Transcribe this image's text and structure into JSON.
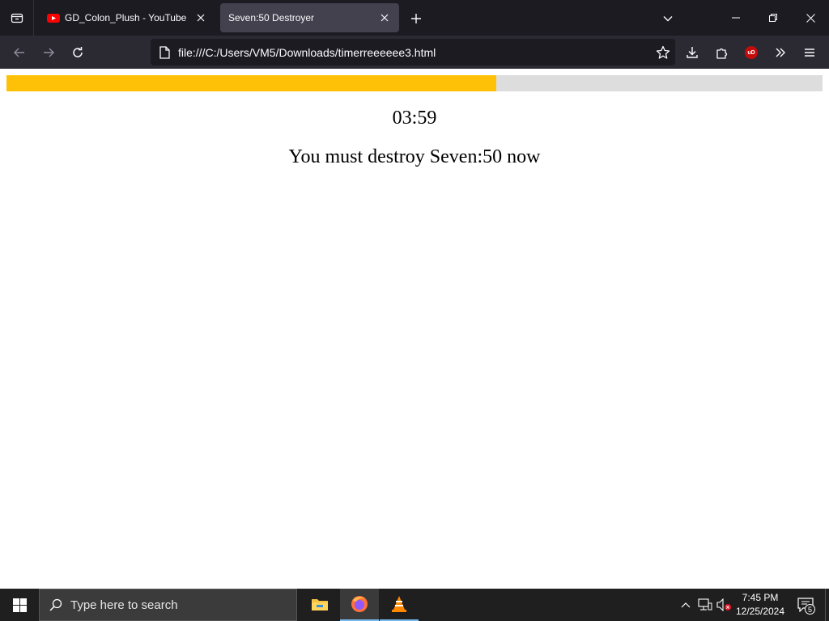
{
  "browser": {
    "tabs": [
      {
        "title": "GD_Colon_Plush - YouTube",
        "favicon": "youtube-icon",
        "active": false
      },
      {
        "title": "Seven:50 Destroyer",
        "active": true
      }
    ],
    "url": "file:///C:/Users/VM5/Downloads/timerreeeeee3.html",
    "extension_badge": "uD"
  },
  "page": {
    "progress_fraction": 0.6,
    "progress_color": "#ffc107",
    "track_color": "#dddddd",
    "timer": "03:59",
    "message": "You must destroy Seven:50 now"
  },
  "taskbar": {
    "search_placeholder": "Type here to search",
    "apps": [
      "file-explorer-icon",
      "firefox-icon",
      "vlc-icon"
    ],
    "time": "7:45 PM",
    "date": "12/25/2024",
    "notification_count": "5"
  }
}
